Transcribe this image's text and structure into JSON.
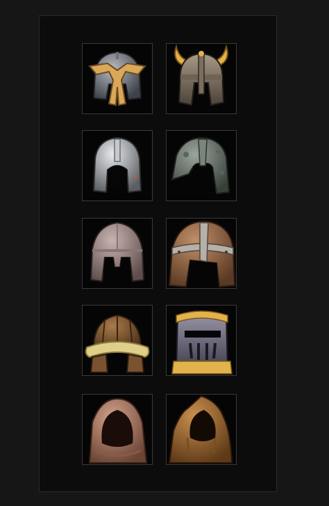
{
  "inventory": {
    "slots": [
      {
        "item": "gold-winged-steel-helmet-icon"
      },
      {
        "item": "horned-viking-helmet-icon"
      },
      {
        "item": "silver-open-face-helmet-icon"
      },
      {
        "item": "dented-iron-helmet-icon"
      },
      {
        "item": "rose-steel-nasal-helmet-icon"
      },
      {
        "item": "leather-banded-helmet-icon"
      },
      {
        "item": "fur-trimmed-leather-cap-icon"
      },
      {
        "item": "gold-banded-great-helm-icon"
      },
      {
        "item": "pink-cloth-hood-icon"
      },
      {
        "item": "brown-cloth-hood-icon"
      }
    ]
  },
  "colors": {
    "background": "#161616",
    "panel": "#0c0c0c",
    "slot_border": "#3a3a3a",
    "gold_trim": "#d9a85a",
    "steel": "#8f949a",
    "leather": "#8a5a3a"
  }
}
